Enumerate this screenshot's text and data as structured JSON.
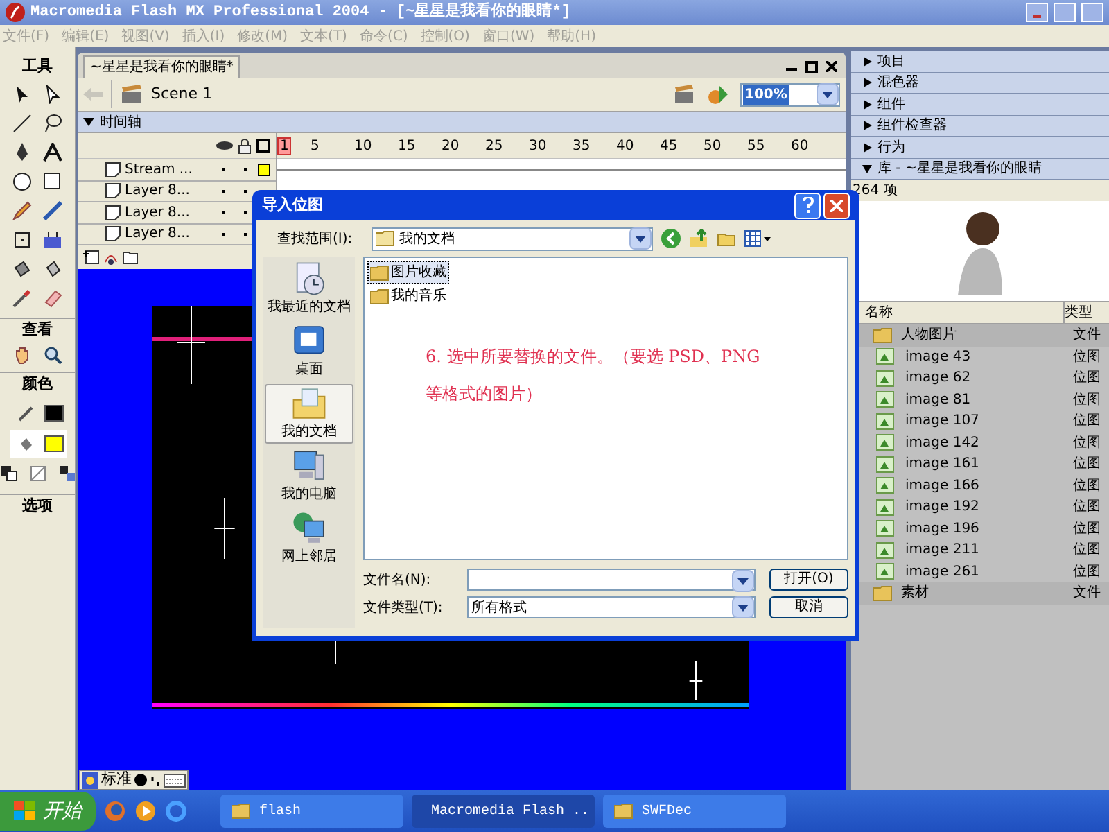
{
  "window": {
    "title": "Macromedia Flash MX Professional 2004 - [~星星是我看你的眼睛*]"
  },
  "menu": [
    "文件(F)",
    "编辑(E)",
    "视图(V)",
    "插入(I)",
    "修改(M)",
    "文本(T)",
    "命令(C)",
    "控制(O)",
    "窗口(W)",
    "帮助(H)"
  ],
  "tools": {
    "title": "工具",
    "view_title": "查看",
    "colors_title": "颜色",
    "options_title": "选项"
  },
  "document": {
    "tab": "~星星是我看你的眼睛*",
    "scene": "Scene 1",
    "zoom": "100%",
    "timeline_title": "时间轴",
    "frame_numbers": [
      "1",
      "5",
      "10",
      "15",
      "20",
      "25",
      "30",
      "35",
      "40",
      "45",
      "50",
      "55",
      "60"
    ],
    "layers": [
      {
        "name": "Stream ..."
      },
      {
        "name": "Layer 8..."
      },
      {
        "name": "Layer 8..."
      },
      {
        "name": "Layer 8..."
      }
    ]
  },
  "panels": [
    {
      "label": "项目",
      "expanded": false
    },
    {
      "label": "混色器",
      "expanded": false
    },
    {
      "label": "组件",
      "expanded": false
    },
    {
      "label": "组件检查器",
      "expanded": false
    },
    {
      "label": "行为",
      "expanded": false
    },
    {
      "label": "库 - ~星星是我看你的眼睛",
      "expanded": true
    }
  ],
  "library": {
    "count": "264 项",
    "columns": [
      "名称",
      "类型"
    ],
    "rows": [
      {
        "kind": "folder",
        "name": "人物图片",
        "type": "文件",
        "children": [
          {
            "kind": "bitmap",
            "name": "image 43",
            "type": "位图"
          },
          {
            "kind": "bitmap",
            "name": "image 62",
            "type": "位图"
          },
          {
            "kind": "bitmap",
            "name": "image 81",
            "type": "位图"
          },
          {
            "kind": "bitmap",
            "name": "image 107",
            "type": "位图"
          },
          {
            "kind": "bitmap",
            "name": "image 142",
            "type": "位图"
          },
          {
            "kind": "bitmap",
            "name": "image 161",
            "type": "位图"
          },
          {
            "kind": "bitmap",
            "name": "image 166",
            "type": "位图"
          },
          {
            "kind": "bitmap",
            "name": "image 192",
            "type": "位图"
          },
          {
            "kind": "bitmap",
            "name": "image 196",
            "type": "位图"
          },
          {
            "kind": "bitmap",
            "name": "image 211",
            "type": "位图"
          },
          {
            "kind": "bitmap",
            "name": "image 261",
            "type": "位图"
          }
        ]
      },
      {
        "kind": "folder",
        "name": "素材",
        "type": "文件"
      }
    ]
  },
  "dialog": {
    "title": "导入位图",
    "look_in_label": "查找范围(I):",
    "look_in": "我的文档",
    "places": [
      {
        "kind": "recent",
        "label": "我最近的文档",
        "selected": false
      },
      {
        "kind": "desktop",
        "label": "桌面",
        "selected": false
      },
      {
        "kind": "documents",
        "label": "我的文档",
        "selected": true
      },
      {
        "kind": "computer",
        "label": "我的电脑",
        "selected": false
      },
      {
        "kind": "network",
        "label": "网上邻居",
        "selected": false
      }
    ],
    "files": [
      {
        "name": "图片收藏",
        "selected": true
      },
      {
        "name": "我的音乐",
        "selected": false
      }
    ],
    "annotation": "6. 选中所要替换的文件。（要选 PSD、PNG 等格式的图片）",
    "file_name_label": "文件名(N):",
    "file_type_label": "文件类型(T):",
    "file_type": "所有格式",
    "buttons": [
      "打开(O)",
      "取消"
    ]
  },
  "ime": {
    "label": "标准"
  },
  "taskbar": {
    "start": "开始",
    "tasks": [
      {
        "label": "flash",
        "active": false,
        "kind": "folder"
      },
      {
        "label": "Macromedia Flash ..",
        "active": true,
        "kind": "app"
      },
      {
        "label": "SWFDec",
        "active": false,
        "kind": "folder"
      }
    ]
  }
}
